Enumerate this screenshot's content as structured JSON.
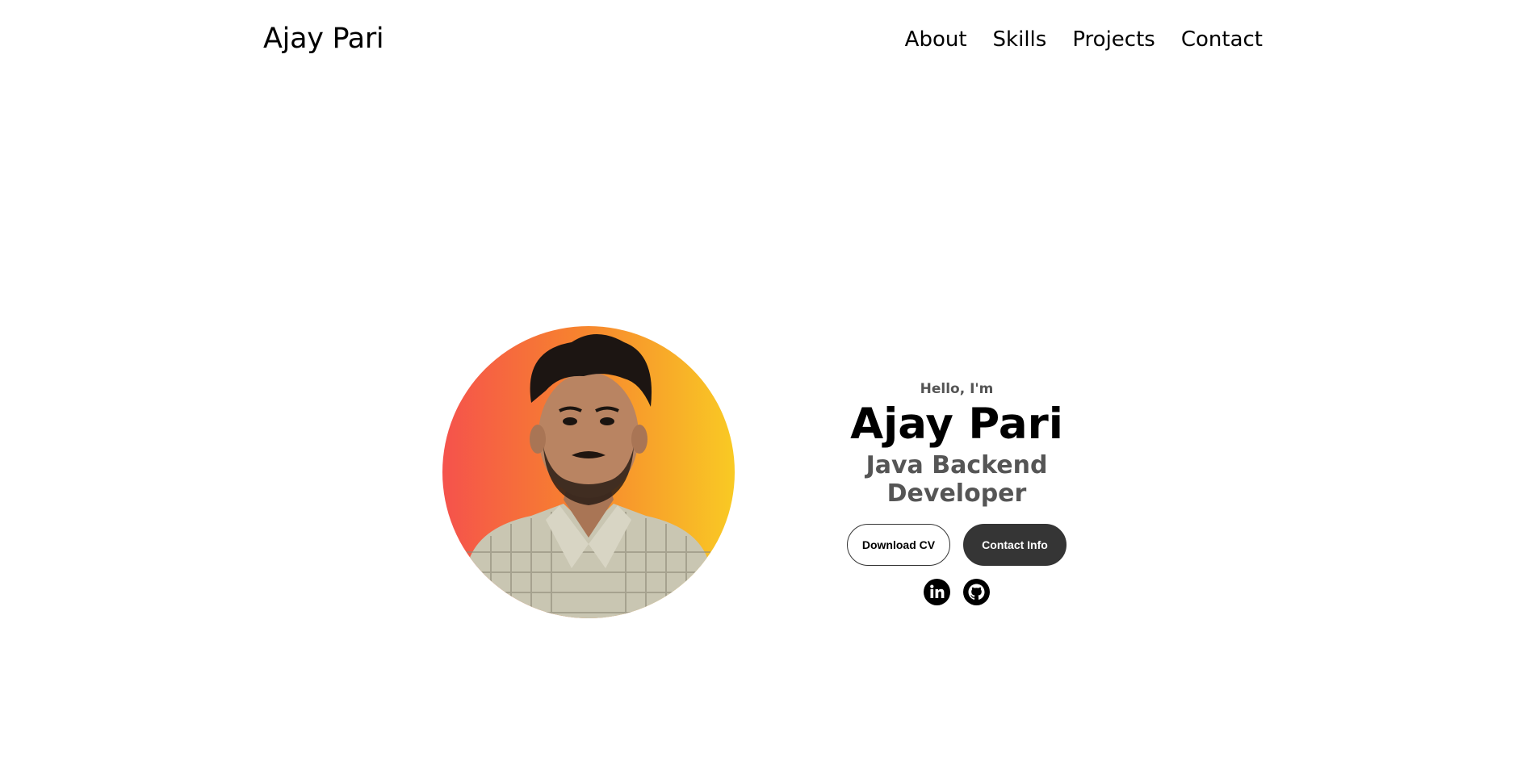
{
  "nav": {
    "logo": "Ajay Pari",
    "links": [
      "About",
      "Skills",
      "Projects",
      "Contact"
    ]
  },
  "hero": {
    "greeting": "Hello, I'm",
    "name": "Ajay Pari",
    "role": "Java Backend Developer",
    "buttons": {
      "download": "Download CV",
      "contact": "Contact Info"
    },
    "socials": [
      "linkedin-icon",
      "github-icon"
    ]
  },
  "colors": {
    "gradient_start": "#f5524c",
    "gradient_mid": "#f7812f",
    "gradient_end": "#f9ca24",
    "button_dark": "#353535",
    "text_muted": "#555555"
  }
}
